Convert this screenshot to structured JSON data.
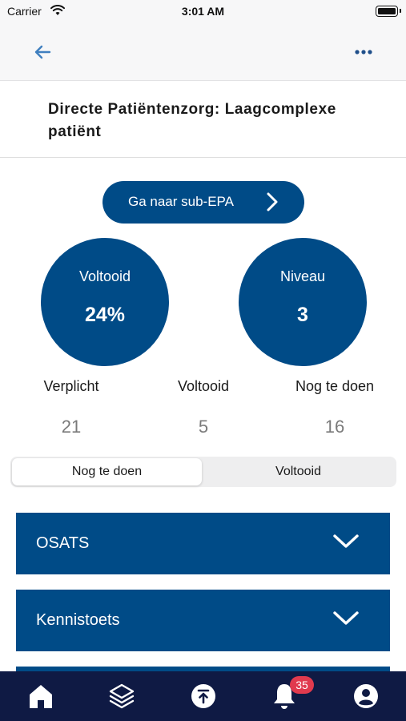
{
  "status_bar": {
    "carrier": "Carrier",
    "time": "3:01 AM"
  },
  "nav": {
    "back_icon": "arrow-left-icon",
    "more_icon": "ellipsis-icon"
  },
  "page": {
    "title": "Directe Patiëntenzorg: Laagcomplexe patiënt"
  },
  "sub_epa_button": {
    "label": "Ga naar sub-EPA"
  },
  "circles": [
    {
      "label": "Voltooid",
      "value": "24%"
    },
    {
      "label": "Niveau",
      "value": "3"
    }
  ],
  "stats": [
    {
      "label": "Verplicht",
      "value": "21"
    },
    {
      "label": "Voltooid",
      "value": "5"
    },
    {
      "label": "Nog te doen",
      "value": "16"
    }
  ],
  "segmented": {
    "options": [
      "Nog te doen",
      "Voltooid"
    ],
    "selected": "Nog te doen"
  },
  "accordions": [
    {
      "label": "OSATS"
    },
    {
      "label": "Kennistoets"
    },
    {
      "label": ""
    }
  ],
  "tab_bar": {
    "items": [
      {
        "icon": "home-icon"
      },
      {
        "icon": "layers-icon"
      },
      {
        "icon": "upload-icon"
      },
      {
        "icon": "bell-icon",
        "badge": "35"
      },
      {
        "icon": "profile-icon"
      }
    ]
  },
  "colors": {
    "primary": "#004b87",
    "tab_bar": "#0f1a44",
    "badge": "#e03a4e",
    "back_arrow": "#3f7fbf"
  }
}
